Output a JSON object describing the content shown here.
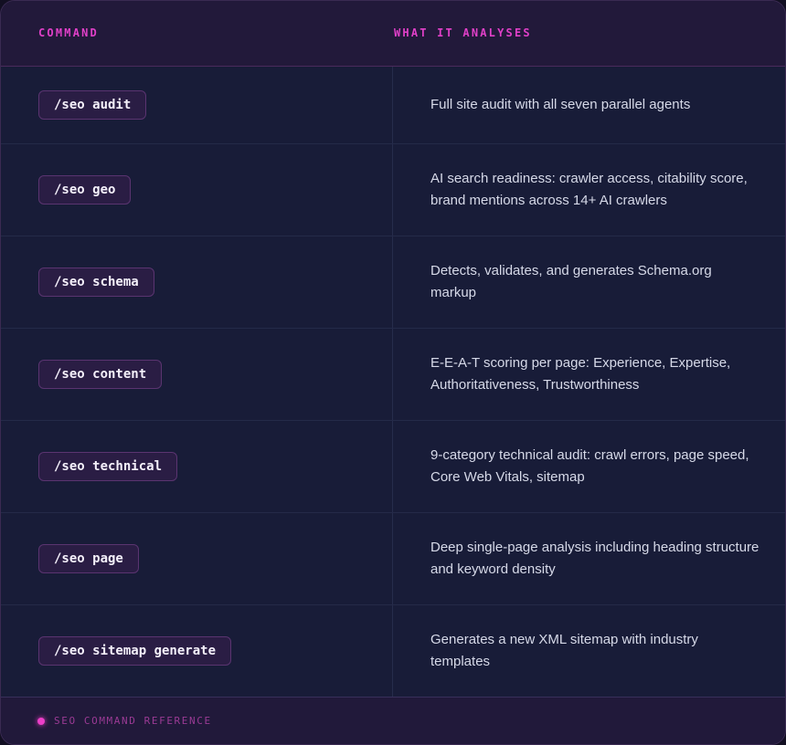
{
  "table": {
    "headers": {
      "command": "COMMAND",
      "description": "WHAT IT ANALYSES"
    },
    "rows": [
      {
        "command": "/seo audit",
        "description": "Full site audit with all seven parallel agents"
      },
      {
        "command": "/seo geo",
        "description": "AI search readiness: crawler access, citability score, brand mentions across 14+ AI crawlers"
      },
      {
        "command": "/seo schema",
        "description": "Detects, validates, and generates Schema.org markup"
      },
      {
        "command": "/seo content",
        "description": "E-E-A-T scoring per page: Experience, Expertise, Authoritativeness, Trustworthiness"
      },
      {
        "command": "/seo technical",
        "description": "9-category technical audit: crawl errors, page speed, Core Web Vitals, sitemap"
      },
      {
        "command": "/seo page",
        "description": "Deep single-page analysis including heading structure and keyword density"
      },
      {
        "command": "/seo sitemap generate",
        "description": "Generates a new XML sitemap with industry templates"
      }
    ]
  },
  "footer": {
    "label": "SEO COMMAND REFERENCE",
    "icon": "status-dot-icon"
  },
  "colors": {
    "accent": "#e040c8",
    "background": "#181b36",
    "pill_background": "#2a1d44",
    "pill_border": "#5a3470"
  }
}
